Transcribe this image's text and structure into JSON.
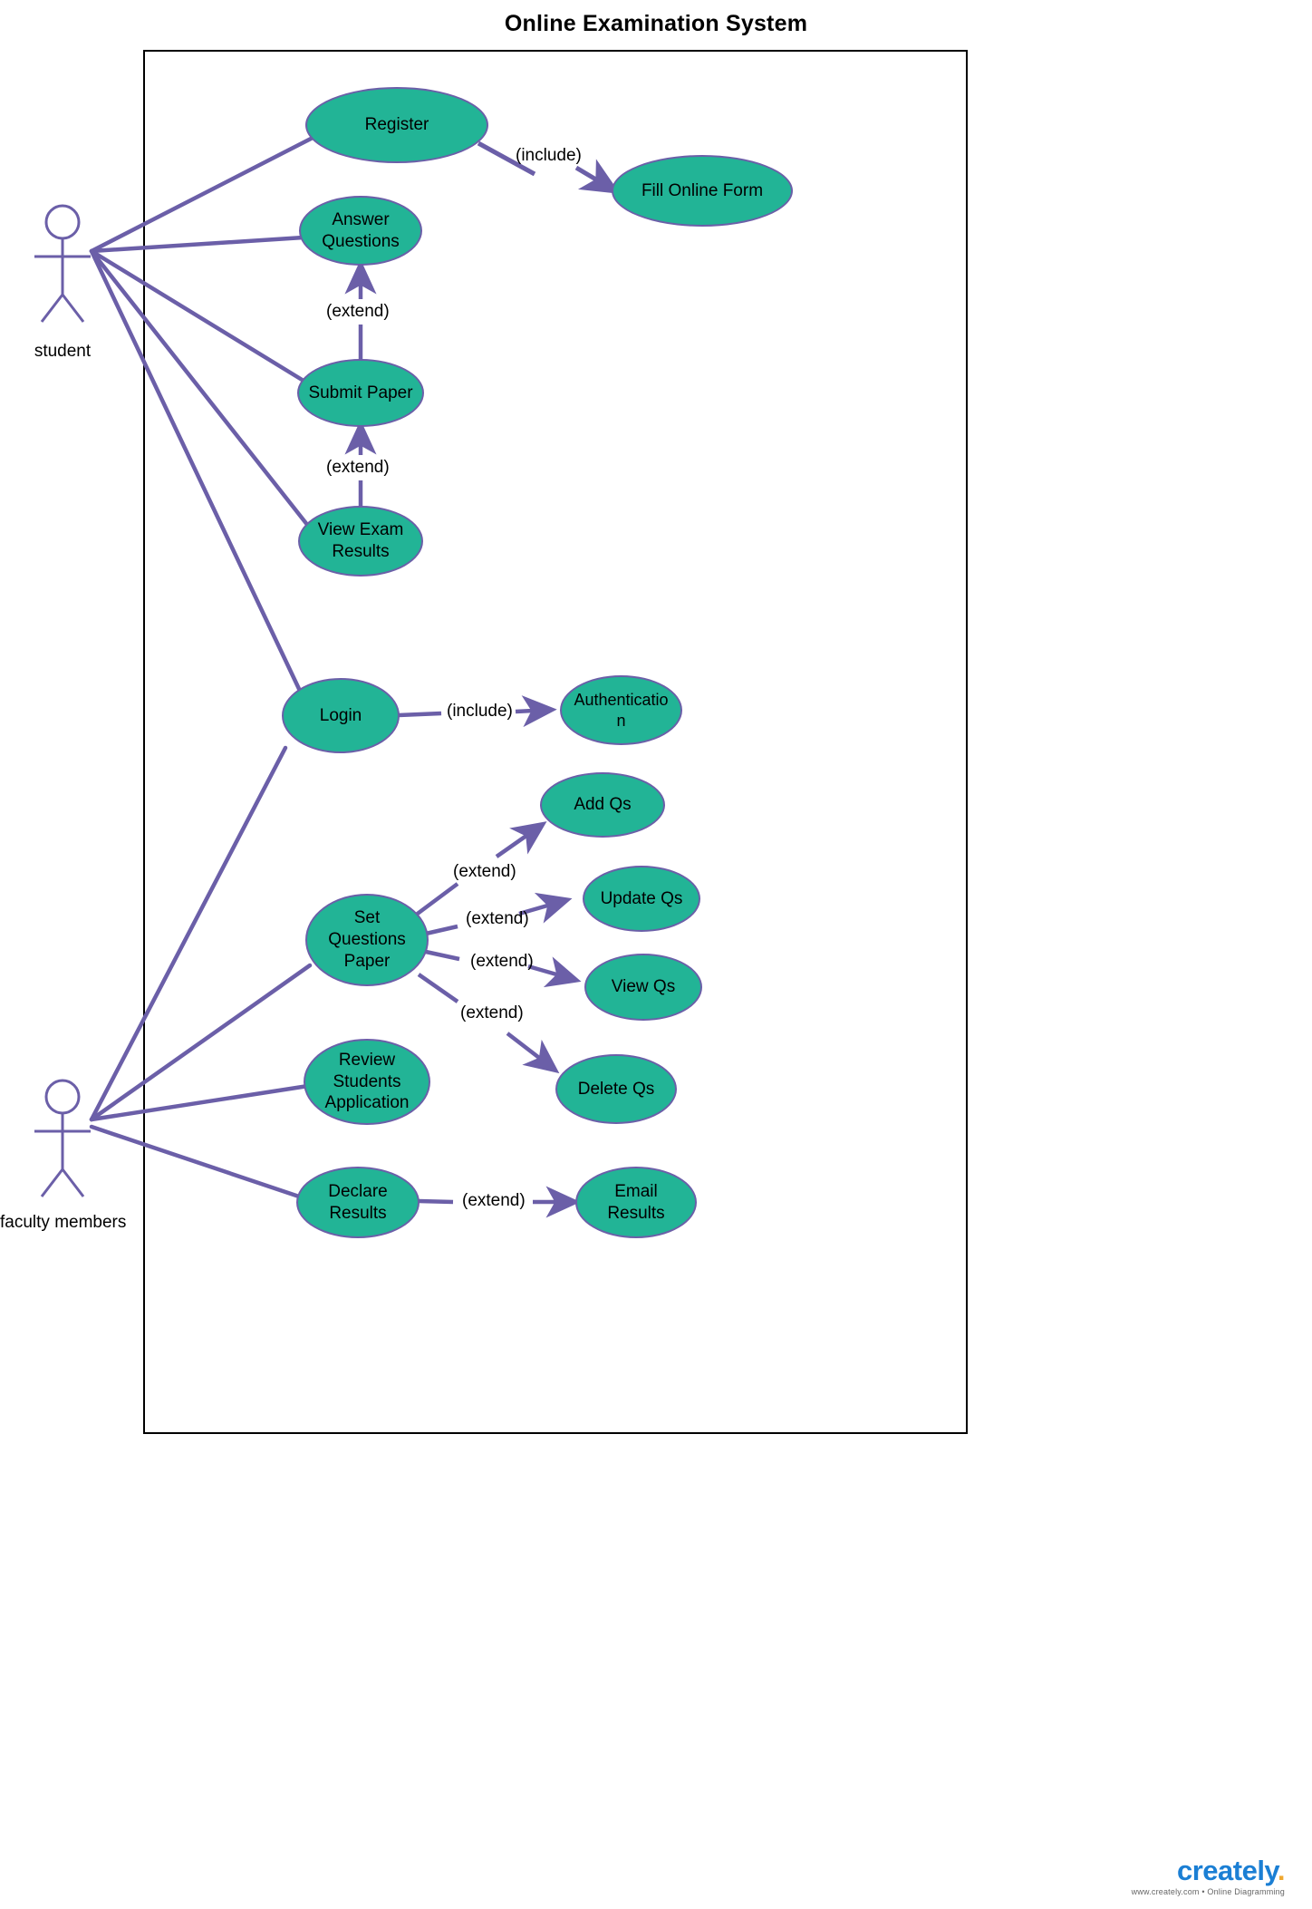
{
  "diagram": {
    "title": "Online Examination System",
    "type": "uml-use-case-diagram",
    "colors": {
      "ellipse_fill": "#22b496",
      "ellipse_stroke": "#6b5fa8",
      "connector": "#6b5fa8",
      "boundary": "#000000",
      "text": "#000000"
    }
  },
  "actors": [
    {
      "id": "student",
      "label": "student"
    },
    {
      "id": "faculty",
      "label": "faculty members"
    }
  ],
  "use_cases": [
    {
      "id": "register",
      "label": "Register"
    },
    {
      "id": "fill_form",
      "label": "Fill Online Form"
    },
    {
      "id": "answer_q",
      "label": "Answer\nQuestions"
    },
    {
      "id": "submit_paper",
      "label": "Submit Paper"
    },
    {
      "id": "view_results",
      "label": "View Exam\nResults"
    },
    {
      "id": "login",
      "label": "Login"
    },
    {
      "id": "authentication",
      "label": "Authenticatio\nn"
    },
    {
      "id": "add_qs",
      "label": "Add Qs"
    },
    {
      "id": "set_questions",
      "label": "Set\nQuestions\nPaper"
    },
    {
      "id": "update_qs",
      "label": "Update Qs"
    },
    {
      "id": "view_qs",
      "label": "View Qs"
    },
    {
      "id": "delete_qs",
      "label": "Delete Qs"
    },
    {
      "id": "review_app",
      "label": "Review\nStudents\nApplication"
    },
    {
      "id": "declare_res",
      "label": "Declare\nResults"
    },
    {
      "id": "email_res",
      "label": "Email\nResults"
    }
  ],
  "relationship_labels": {
    "register_fill_form": "(include)",
    "submit_to_answer": "(extend)",
    "view_to_submit": "(extend)",
    "login_authentication": "(include)",
    "set_add_qs": "(extend)",
    "set_update_qs": "(extend)",
    "set_view_qs": "(extend)",
    "set_delete_qs": "(extend)",
    "declare_email": "(extend)"
  },
  "watermark": {
    "brand_main": "creately",
    "brand_accent": ".",
    "tagline": "www.creately.com • Online Diagramming"
  }
}
